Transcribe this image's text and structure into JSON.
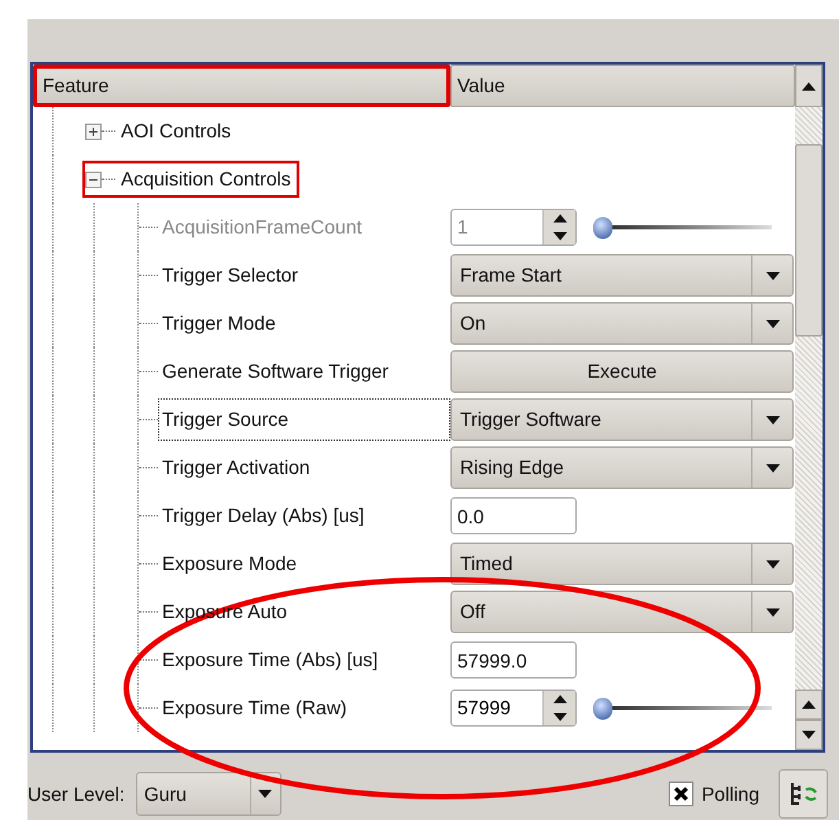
{
  "columns": [
    {
      "label": "Feature",
      "highlighted": true
    },
    {
      "label": "Value",
      "highlighted": false
    }
  ],
  "tree": [
    {
      "label": "AOI Controls",
      "expanded": false,
      "highlighted": false
    },
    {
      "label": "Acquisition Controls",
      "expanded": true,
      "highlighted": true,
      "children": [
        {
          "label": "AcquisitionFrameCount",
          "kind": "spin-slider",
          "value": "1",
          "level": 0.0,
          "disabled": true,
          "selected": false
        },
        {
          "label": "Trigger Selector",
          "kind": "combo",
          "value": "Frame Start",
          "disabled": false,
          "selected": false
        },
        {
          "label": "Trigger Mode",
          "kind": "combo",
          "value": "On",
          "disabled": false,
          "selected": false
        },
        {
          "label": "Generate Software Trigger",
          "kind": "button",
          "value": "Execute",
          "disabled": false,
          "selected": false
        },
        {
          "label": "Trigger Source",
          "kind": "combo",
          "value": "Trigger Software",
          "disabled": false,
          "selected": true
        },
        {
          "label": "Trigger Activation",
          "kind": "combo",
          "value": "Rising Edge",
          "disabled": false,
          "selected": false
        },
        {
          "label": "Trigger Delay (Abs) [us]",
          "kind": "field",
          "value": "0.0",
          "disabled": false,
          "selected": false
        },
        {
          "label": "Exposure Mode",
          "kind": "combo",
          "value": "Timed",
          "disabled": false,
          "selected": false
        },
        {
          "label": "Exposure Auto",
          "kind": "combo",
          "value": "Off",
          "disabled": false,
          "selected": false
        },
        {
          "label": "Exposure Time (Abs) [us]",
          "kind": "field",
          "value": "57999.0",
          "disabled": false,
          "selected": false
        },
        {
          "label": "Exposure Time (Raw)",
          "kind": "spin-slider",
          "value": "57999",
          "level": 0.0,
          "disabled": false,
          "selected": false
        }
      ]
    }
  ],
  "annotation": {
    "kind": "ellipse"
  },
  "footer": {
    "user_level_label": "User Level:",
    "user_level": "Guru",
    "polling": {
      "label": "Polling",
      "checked": true
    }
  }
}
